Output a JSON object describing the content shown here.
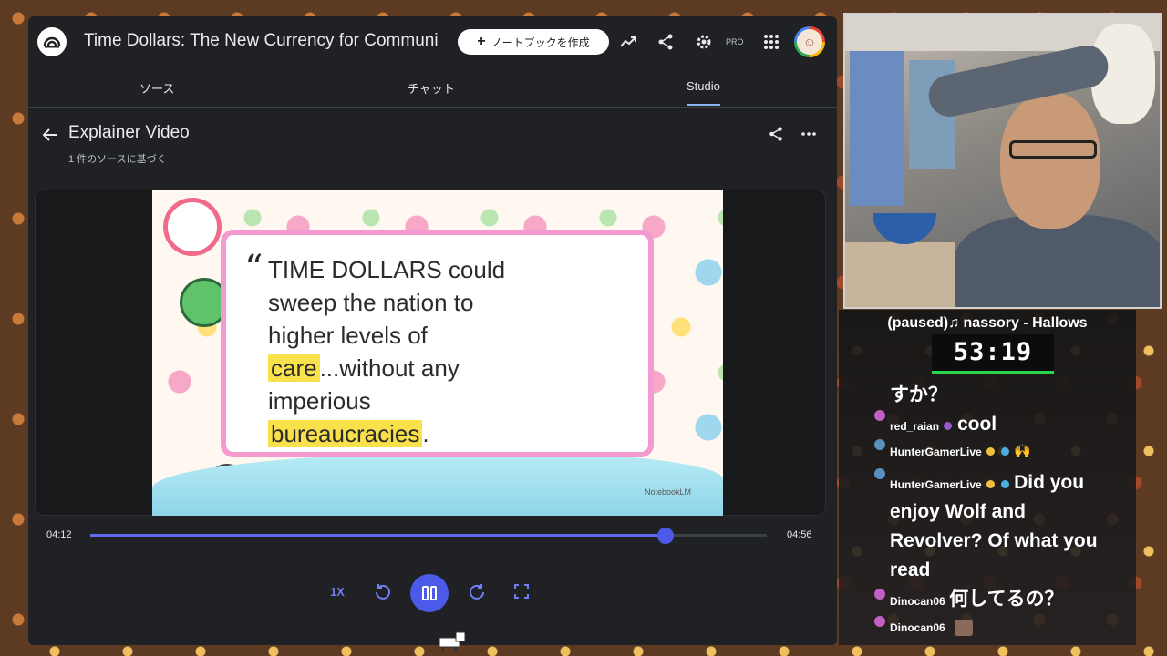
{
  "app": {
    "title": "Time Dollars: The New Currency for Communi",
    "create_label": "ノートブックを作成",
    "pro_label": "PRO"
  },
  "tabs": [
    {
      "label": "ソース"
    },
    {
      "label": "チャット"
    },
    {
      "label": "Studio"
    }
  ],
  "panel": {
    "title": "Explainer Video",
    "subtitle": "1 件のソースに基づく"
  },
  "slide": {
    "line1": "TIME DOLLARS could",
    "line2": "sweep the nation to",
    "line3": "higher levels of",
    "care": "care",
    "line4_rest": "...without any",
    "line5": "imperious",
    "bureau": "bureaucracies",
    "period": ".",
    "watermark": "NotebookLM"
  },
  "player": {
    "current_time": "04:12",
    "total_time": "04:56",
    "progress": 0.85,
    "speed_label": "1X"
  },
  "stream": {
    "now_playing": "(paused)♫ nassory - Hallows",
    "timer": "53:19",
    "chat": [
      {
        "user": "",
        "text": "すか？"
      },
      {
        "user": "red_raian",
        "text": "cool"
      },
      {
        "user": "HunterGamerLive",
        "text": ""
      },
      {
        "user": "HunterGamerLive",
        "text": "Did you"
      },
      {
        "user": "",
        "text": "enjoy Wolf and"
      },
      {
        "user": "",
        "text": "Revolver? Of what you"
      },
      {
        "user": "",
        "text": "read"
      },
      {
        "user": "Dinocan06",
        "text": "何してるの？"
      },
      {
        "user": "Dinocan06",
        "text": ""
      }
    ]
  },
  "colors": {
    "accent": "#4b5ae8",
    "highlight": "#f8e14a",
    "card_border": "#f39ad0",
    "timer_bar": "#2bd44a"
  }
}
